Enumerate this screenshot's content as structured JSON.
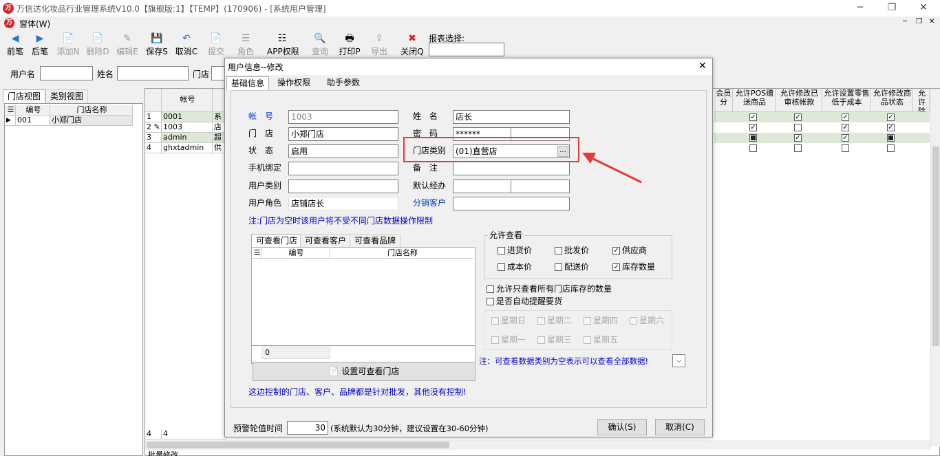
{
  "window": {
    "title": "万信达化妆品行业管理系统V10.0【旗舰版:1】【TEMP】(170906) - [系统用户管理]",
    "logo_text": "万",
    "min": "─",
    "restore": "❐",
    "close": "✕"
  },
  "menu": {
    "item": "窗体(W)",
    "mdi_min": "─",
    "mdi_restore": "❐",
    "mdi_close": "✕"
  },
  "toolbar": {
    "items": [
      {
        "label": "前笔",
        "icon": "◀"
      },
      {
        "label": "后笔",
        "icon": "▶"
      },
      {
        "label": "添加N",
        "icon": "📄"
      },
      {
        "label": "删除D",
        "icon": "📄"
      },
      {
        "label": "编辑E",
        "icon": "✎"
      },
      {
        "label": "保存S",
        "icon": "💾"
      },
      {
        "label": "取消C",
        "icon": "↶"
      },
      {
        "label": "提交",
        "icon": "📄"
      },
      {
        "label": "角色",
        "icon": "☰"
      },
      {
        "label": "APP权限",
        "icon": "☷"
      },
      {
        "label": "查询",
        "icon": "🔍"
      },
      {
        "label": "打印P",
        "icon": "🖶"
      },
      {
        "label": "导出",
        "icon": "⇪"
      },
      {
        "label": "关闭Q",
        "icon": "✖"
      }
    ],
    "report_label": "报表选择:"
  },
  "filter": {
    "user_label": "用户名",
    "name_label": "姓名",
    "store_label": "门店"
  },
  "left_tabs": {
    "store_view": "门店视图",
    "category_view": "类别视图"
  },
  "store_tree": {
    "col_code": "编号",
    "col_name": "门店名称",
    "rows": [
      {
        "code": "001",
        "name": "小郑门店"
      }
    ]
  },
  "user_grid": {
    "col_account": "帐号",
    "rows": [
      {
        "n": "1",
        "acc": "0001",
        "x": "系"
      },
      {
        "n": "2",
        "acc": "1003",
        "x": "店"
      },
      {
        "n": "3",
        "acc": "admin",
        "x": "超"
      },
      {
        "n": "4",
        "acc": "ghxtadmin",
        "x": "供"
      }
    ],
    "footer_n": "4",
    "footer_v": "4",
    "right_cols": [
      "会员分",
      "允许POS赠送商品",
      "允许修改已审核帐款",
      "允许设置零售低于成本",
      "允许修改商品状态",
      "允许除"
    ],
    "bottom_text": "批量修改"
  },
  "dialog": {
    "title": "用户信息--修改",
    "close": "✕",
    "tabs": [
      "基础信息",
      "操作权限",
      "助手参数"
    ],
    "account_label": "帐　号",
    "account": "1003",
    "name_label": "姓　名",
    "name": "店长",
    "store_label": "门　店",
    "store": "小郑门店",
    "password_label": "密　码",
    "password": "******",
    "status_label": "状　态",
    "status": "启用",
    "store_type_label": "门店类别",
    "store_type": "(01)直营店",
    "browse": "...",
    "phone_label": "手机绑定",
    "phone": "",
    "remark_label": "备　注",
    "remark": "",
    "user_type_label": "用户类别",
    "user_type": "",
    "default_agent_label": "默认经办",
    "default_agent": "",
    "role_label": "用户角色",
    "role": "店铺店长",
    "dist_customer_label": "分销客户",
    "dist_customer": "",
    "note1": "注:门店为空时该用户将不受不同门店数据操作限制",
    "sub_tabs": [
      "可查看门店",
      "可查看客户",
      "可查看品牌"
    ],
    "sub_grid": {
      "col_code": "编号",
      "col_name": "门店名称",
      "count": "0"
    },
    "set_store_btn": "设置可查看门店",
    "note2": "这边控制的门店、客户、品牌都是针对批发，其他没有控制!",
    "allow_view": {
      "title": "允许查看",
      "items": [
        {
          "label": "进货价",
          "checked": false
        },
        {
          "label": "批发价",
          "checked": false
        },
        {
          "label": "供应商",
          "checked": true
        },
        {
          "label": "成本价",
          "checked": false
        },
        {
          "label": "配送价",
          "checked": false
        },
        {
          "label": "库存数量",
          "checked": true
        }
      ]
    },
    "only_view_stock": "允许只查看所有门店库存的数量",
    "auto_remind": "是否自动提醒要货",
    "weekdays": [
      "星期日",
      "星期二",
      "星期四",
      "星期六",
      "星期一",
      "星期三",
      "星期五"
    ],
    "note3": "注：可查看数据类别为空表示可以查看全部数据!",
    "poll_label": "预警轮值时间",
    "poll_value": "30",
    "poll_hint": "(系统默认为30分钟，建议设置在30-60分钟)",
    "ok": "确认(S)",
    "cancel": "取消(C)"
  },
  "colors": {
    "highlight": "#e53935",
    "selected_row": "#dde8d6",
    "link_blue": "#0000cc"
  }
}
